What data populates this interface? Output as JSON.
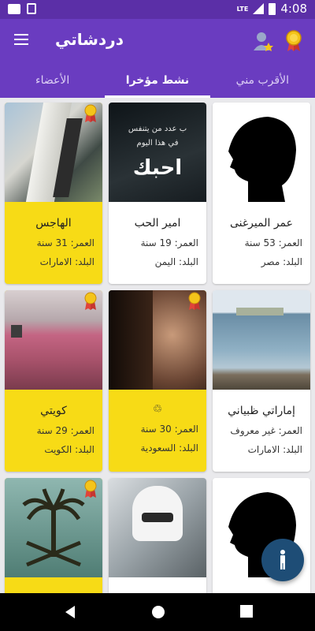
{
  "status_bar": {
    "time": "4:08",
    "network": "LTE"
  },
  "app_bar": {
    "title": "دردشاتي"
  },
  "tabs": [
    {
      "label": "الأقرب مني"
    },
    {
      "label": "نشط مؤخرا"
    },
    {
      "label": "الأعضاء"
    }
  ],
  "cards": [
    {
      "name": "عمر الميرغنى",
      "age": "العمر: 53 سنة",
      "country": "البلد: مصر"
    },
    {
      "name": "امير الحب",
      "age": "العمر: 19 سنة",
      "country": "البلد: اليمن",
      "photo_text": {
        "line1": "ب عدد من يتنفس",
        "line2": "في هذا اليوم",
        "line3": "احبك"
      }
    },
    {
      "name": "الهاجس",
      "age": "العمر: 31 سنة",
      "country": "البلد: الامارات"
    },
    {
      "name": "إماراتي ظبياني",
      "age": "العمر: غير معروف",
      "country": "البلد: الامارات"
    },
    {
      "name": "",
      "age": "العمر: 30 سنة",
      "country": "البلد: السعودية"
    },
    {
      "name": "كويتي",
      "age": "العمر: 29 سنة",
      "country": "البلد: الكويت"
    },
    {
      "name": "",
      "age": "",
      "country": ""
    },
    {
      "name": "",
      "age": "",
      "country": ""
    },
    {
      "name": "",
      "age": "",
      "country": ""
    }
  ],
  "colors": {
    "primary": "#6a3cc0",
    "status": "#5b2fa7",
    "gold": "#f7db16",
    "fab": "#1e4d76"
  }
}
